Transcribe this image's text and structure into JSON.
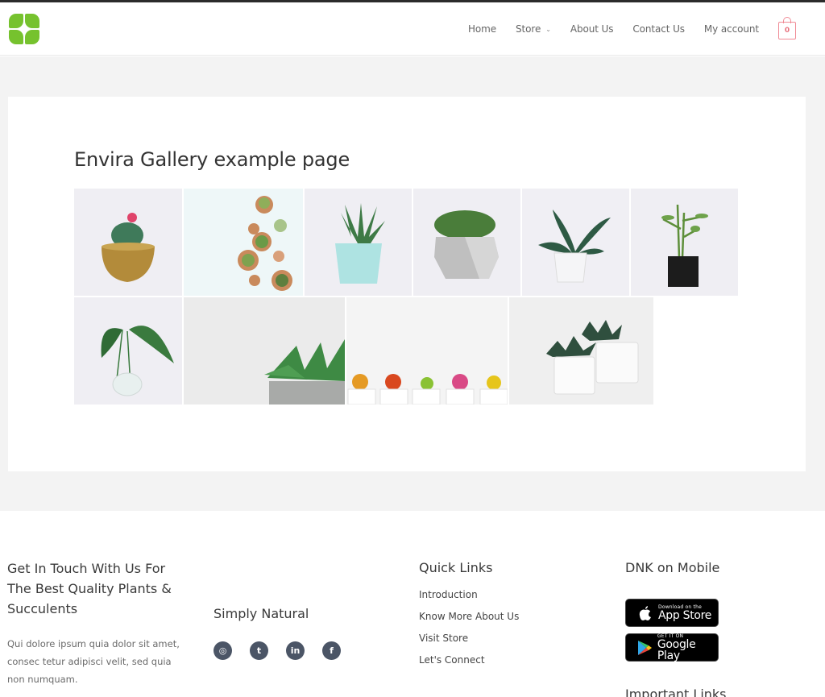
{
  "header": {
    "logo_alt": "DNK leaf logo",
    "nav": [
      {
        "label": "Home",
        "has_dropdown": false
      },
      {
        "label": "Store",
        "has_dropdown": true
      },
      {
        "label": "About Us",
        "has_dropdown": false
      },
      {
        "label": "Contact Us",
        "has_dropdown": false
      },
      {
        "label": "My account",
        "has_dropdown": false
      }
    ],
    "cart_count": "0"
  },
  "main": {
    "title": "Envira Gallery example page",
    "gallery": [
      {
        "name": "cactus-gold-pot",
        "subject": "cactus with pink flower in gold pot"
      },
      {
        "name": "succulents-top-view",
        "subject": "assorted succulents in terracotta pots, top view"
      },
      {
        "name": "aloe-mint-pot",
        "subject": "aloe in mint blue pot"
      },
      {
        "name": "moss-concrete-pot",
        "subject": "moss in geometric concrete pot"
      },
      {
        "name": "snake-plant-white-pot",
        "subject": "striped plant in white pot"
      },
      {
        "name": "seedling-black-bag",
        "subject": "seedling in black grow bag"
      },
      {
        "name": "leaves-glass-vase",
        "subject": "leaves in glass vase"
      },
      {
        "name": "succulent-grey-pot",
        "subject": "green succulent in grey pot"
      },
      {
        "name": "colorful-cacti-row",
        "subject": "row of colorful cacti in white pots"
      },
      {
        "name": "haworthia-white-pots",
        "subject": "haworthia in white ribbed pots"
      }
    ]
  },
  "footer": {
    "col1": {
      "heading": "Get In Touch With Us For The Best Quality Plants & Succulents",
      "text": "Qui dolore ipsum quia dolor sit amet, consec tetur adipisci velit, sed quia non numquam."
    },
    "col2": {
      "heading": "Simply Natural",
      "social": [
        {
          "icon": "instagram-icon",
          "glyph": "◎"
        },
        {
          "icon": "twitter-icon",
          "glyph": "t"
        },
        {
          "icon": "linkedin-icon",
          "glyph": "in"
        },
        {
          "icon": "facebook-icon",
          "glyph": "f"
        }
      ]
    },
    "col3": {
      "heading": "Quick Links",
      "links": [
        "Introduction",
        "Know More About Us",
        "Visit Store",
        "Let's Connect"
      ]
    },
    "col4": {
      "heading": "DNK on Mobile",
      "app_store": {
        "small": "Download on the",
        "big": "App Store"
      },
      "google_play": {
        "small": "GET IT ON",
        "big": "Google Play"
      },
      "next_heading": "Important Links"
    }
  },
  "colors": {
    "brand_green": "#76c22e",
    "cart_pink": "#f08a95",
    "social_bg": "#4b5566",
    "page_bg": "#f3f3f3"
  }
}
